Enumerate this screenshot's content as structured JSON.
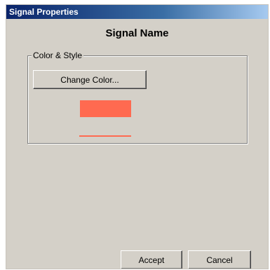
{
  "window": {
    "title": "Signal Properties"
  },
  "signal": {
    "name": "Signal Name"
  },
  "group": {
    "legend": "Color & Style",
    "change_color_label": "Change Color...",
    "color": "#ff6a50",
    "line_color": "#ff6a50"
  },
  "footer": {
    "accept_label": "Accept",
    "cancel_label": "Cancel"
  }
}
